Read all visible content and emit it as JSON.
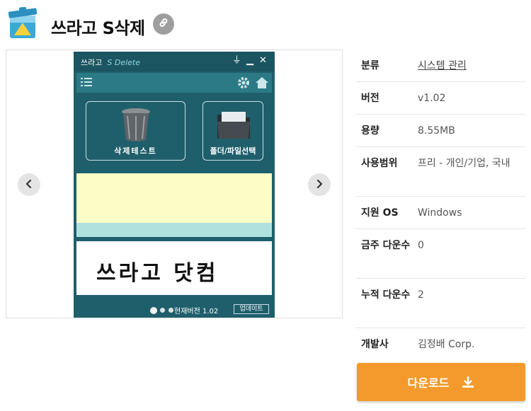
{
  "header": {
    "title": "쓰라고 S삭제"
  },
  "screenshot": {
    "window_title_prefix": "쓰라고",
    "window_title_suffix": "S Delete",
    "delete_test_label": "삭제테스트",
    "folder_file_label": "폴더/파일선택",
    "banner_text": "쓰라고 닷컴",
    "version_text": "현재버전  1.02",
    "update_label": "업데이트"
  },
  "info": {
    "category_label": "분류",
    "category_value": "시스템 관리",
    "version_label": "버전",
    "version_value": "v1.02",
    "size_label": "용량",
    "size_value": "8.55MB",
    "license_label": "사용범위",
    "license_value": "프리 - 개인/기업, 국내",
    "os_label": "지원 OS",
    "os_value": "Windows",
    "weekly_label": "금주 다운수",
    "weekly_value": "0",
    "total_label": "누적 다운수",
    "total_value": "2",
    "dev_label": "개발사",
    "dev_value": "김정배 Corp."
  },
  "download": {
    "label": "다운로드"
  },
  "colors": {
    "accent": "#f49a2c",
    "app_teal": "#1f5f6b",
    "link_button": "#9e9e9e"
  },
  "icons": [
    "app-logo-icon",
    "link-icon",
    "chevron-left-icon",
    "chevron-right-icon",
    "trash-can-icon",
    "folder-icon",
    "gear-icon",
    "home-icon",
    "list-icon",
    "download-icon"
  ]
}
